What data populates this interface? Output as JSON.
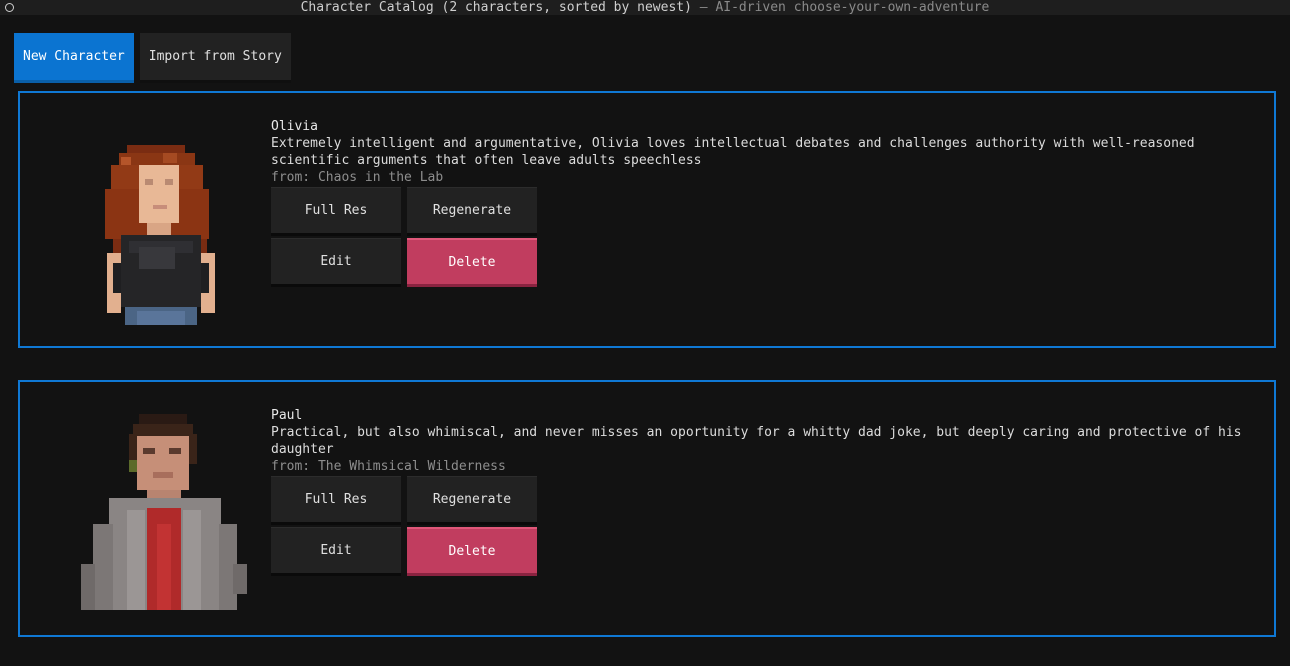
{
  "window": {
    "title_main": "Character Catalog (2 characters, sorted by newest)",
    "title_sep": " — ",
    "title_sub": "AI-driven choose-your-own-adventure"
  },
  "toolbar": {
    "new_character_label": "New Character",
    "import_label": "Import from Story"
  },
  "characters": [
    {
      "name": "Olivia",
      "description": "Extremely intelligent and argumentative, Olivia loves intellectual debates and challenges authority with well-reasoned scientific arguments that often leave adults speechless",
      "from": "from: Chaos in the Lab",
      "buttons": {
        "full_res": "Full Res",
        "regenerate": "Regenerate",
        "edit": "Edit",
        "delete": "Delete"
      }
    },
    {
      "name": "Paul",
      "description": "Practical, but also whimiscal, and never misses an oportunity for a whitty dad joke, but deeply caring and protective of his daughter",
      "from": "from: The Whimsical Wilderness",
      "buttons": {
        "full_res": "Full Res",
        "regenerate": "Regenerate",
        "edit": "Edit",
        "delete": "Delete"
      }
    }
  ],
  "colors": {
    "accent": "#0f78d4",
    "primary_button": "#0b74d1",
    "danger_button": "#c13d5f",
    "background": "#121212"
  }
}
